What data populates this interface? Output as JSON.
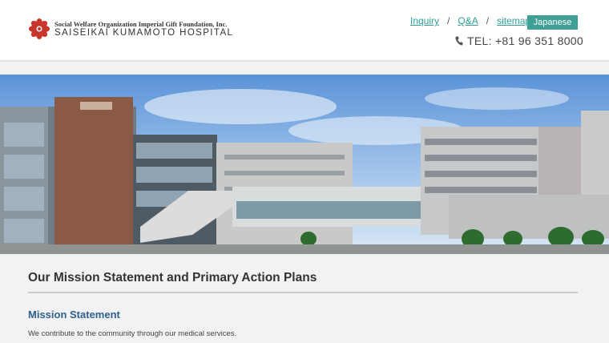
{
  "header": {
    "org_line": "Social Welfare Organization Imperial Gift Foundation, Inc.",
    "hospital_name": "SAISEIKAI KUMAMOTO HOSPITAL",
    "nav": {
      "inquiry": "Inquiry",
      "qa": "Q&A",
      "sitemap": "sitemap",
      "separator": "/"
    },
    "language_button": "Japanese",
    "tel": "TEL: +81 96 351 8000"
  },
  "main": {
    "page_title": "Our Mission Statement and Primary Action Plans",
    "section_title": "Mission Statement",
    "section_text": "We contribute to the community through our medical services."
  },
  "colors": {
    "accent_teal": "#3e9f95",
    "link_teal": "#2e9c95",
    "heading_blue": "#2f5f8f",
    "logo_red": "#c0392b"
  }
}
